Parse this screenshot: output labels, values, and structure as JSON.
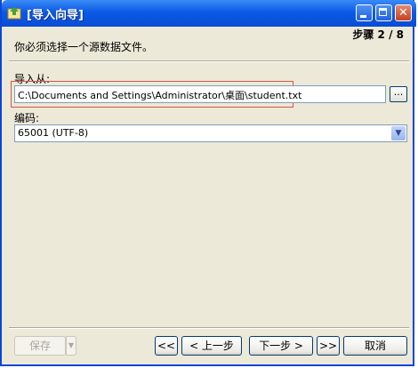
{
  "window": {
    "title": "[导入向导]",
    "step": "步骤 2 / 8"
  },
  "heading": "你必须选择一个源数据文件。",
  "import_from": {
    "label": "导入从:",
    "value": "C:\\Documents and Settings\\Administrator\\桌面\\student.txt",
    "browse_label": "..."
  },
  "encoding": {
    "label": "编码:",
    "value": "65001 (UTF-8)"
  },
  "buttons": {
    "save": "保存",
    "first": "<<",
    "prev": "< 上一步",
    "next": "下一步 >",
    "last": ">>",
    "cancel": "取消"
  },
  "icons": {
    "app": "wizard-icon",
    "minimize": "minimize-icon",
    "maximize": "maximize-icon",
    "close": "close-icon",
    "dropdown": "chevron-down-icon"
  }
}
